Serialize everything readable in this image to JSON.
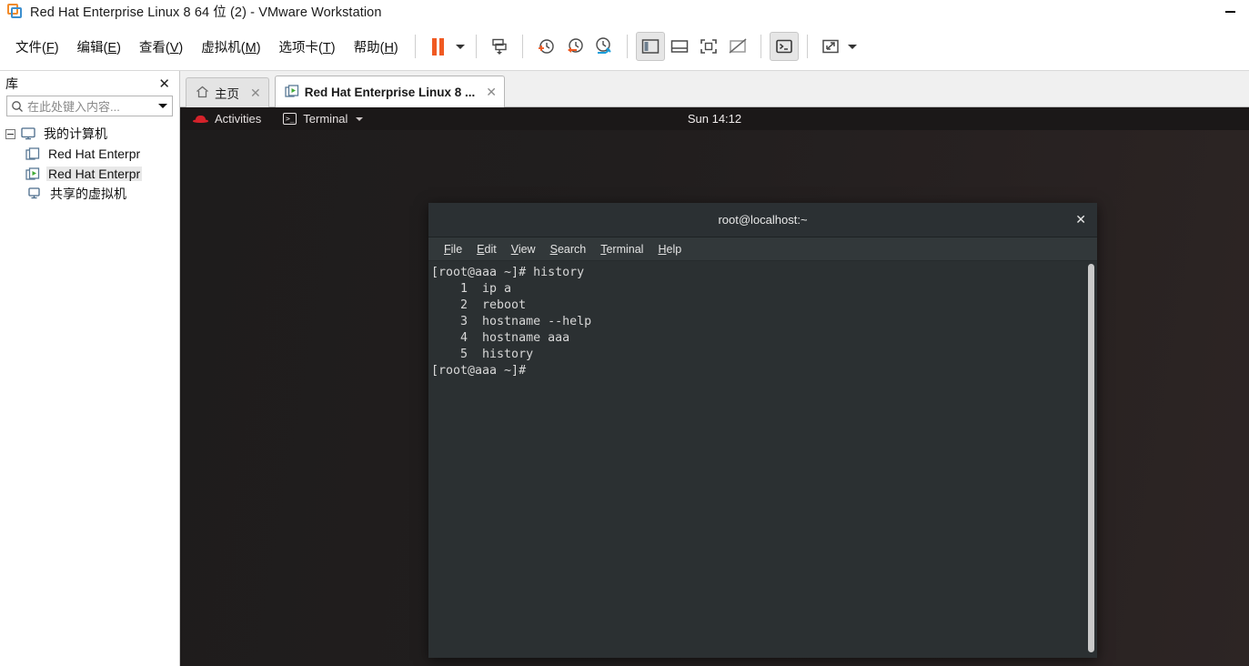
{
  "window": {
    "title": "Red Hat Enterprise Linux 8 64 位 (2) - VMware Workstation",
    "logo_icon": "vmware-logo-icon",
    "minimize_label": "—"
  },
  "menubar": {
    "items": [
      {
        "label": "文件(F)",
        "pre": "文件(",
        "key": "F",
        "post": ")"
      },
      {
        "label": "编辑(E)",
        "pre": "编辑(",
        "key": "E",
        "post": ")"
      },
      {
        "label": "查看(V)",
        "pre": "查看(",
        "key": "V",
        "post": ")"
      },
      {
        "label": "虚拟机(M)",
        "pre": "虚拟机(",
        "key": "M",
        "post": ")"
      },
      {
        "label": "选项卡(T)",
        "pre": "选项卡(",
        "key": "T",
        "post": ")"
      },
      {
        "label": "帮助(H)",
        "pre": "帮助(",
        "key": "H",
        "post": ")"
      }
    ],
    "toolbar_icons": [
      "pause-icon",
      "pause-dropdown-caret-icon",
      "send-ctrl-alt-del-icon",
      "take-snapshot-icon",
      "revert-snapshot-icon",
      "snapshot-manager-icon",
      "show-library-icon",
      "show-thumbnail-bar-icon",
      "full-screen-icon",
      "unity-mode-icon",
      "console-view-icon",
      "stretch-guest-icon",
      "stretch-dropdown-caret-icon"
    ]
  },
  "sidebar": {
    "title": "库",
    "close_label": "✕",
    "search": {
      "placeholder": "在此处键入内容...",
      "icon": "search-icon",
      "dropdown_icon": "chevron-down-icon"
    },
    "tree": [
      {
        "label": "我的计算机",
        "level": 0,
        "icon": "my-computer-icon",
        "expander": "collapse-minus-icon",
        "selected": false
      },
      {
        "label": "Red Hat Enterpr",
        "level": 1,
        "icon": "vm-stopped-icon",
        "selected": false
      },
      {
        "label": "Red Hat Enterpr",
        "level": 1,
        "icon": "vm-running-icon",
        "selected": true
      },
      {
        "label": "共享的虚拟机",
        "level": 0,
        "icon": "shared-vms-icon",
        "selected": false
      }
    ]
  },
  "tabs": [
    {
      "label": "主页",
      "icon": "home-icon",
      "close_label": "✕",
      "active": false
    },
    {
      "label": "Red Hat Enterprise Linux 8 ...",
      "icon": "vm-running-icon",
      "close_label": "✕",
      "active": true
    }
  ],
  "gnome": {
    "activities": "Activities",
    "activities_icon": "red-hat-icon",
    "app_menu": "Terminal",
    "app_menu_icon": "terminal-icon",
    "app_menu_caret": "chevron-down-icon",
    "clock": "Sun 14:12"
  },
  "terminal": {
    "title": "root@localhost:~",
    "close_label": "✕",
    "menu": [
      {
        "label": "File",
        "key": "F",
        "rest": "ile"
      },
      {
        "label": "Edit",
        "key": "E",
        "rest": "dit"
      },
      {
        "label": "View",
        "key": "V",
        "rest": "iew"
      },
      {
        "label": "Search",
        "key": "S",
        "rest": "earch"
      },
      {
        "label": "Terminal",
        "key": "T",
        "rest": "erminal"
      },
      {
        "label": "Help",
        "key": "H",
        "rest": "elp"
      }
    ],
    "content": "[root@aaa ~]# history\n    1  ip a\n    2  reboot\n    3  hostname --help\n    4  hostname aaa\n    5  history\n[root@aaa ~]# ",
    "scrollbar": "vertical-scrollbar"
  },
  "colors": {
    "accent_orange": "#f05a22",
    "accent_blue": "#3c8fcf",
    "red_hat_red": "#d5222a",
    "terminal_bg": "#2b3032",
    "desktop_bg": "#211e1e"
  }
}
